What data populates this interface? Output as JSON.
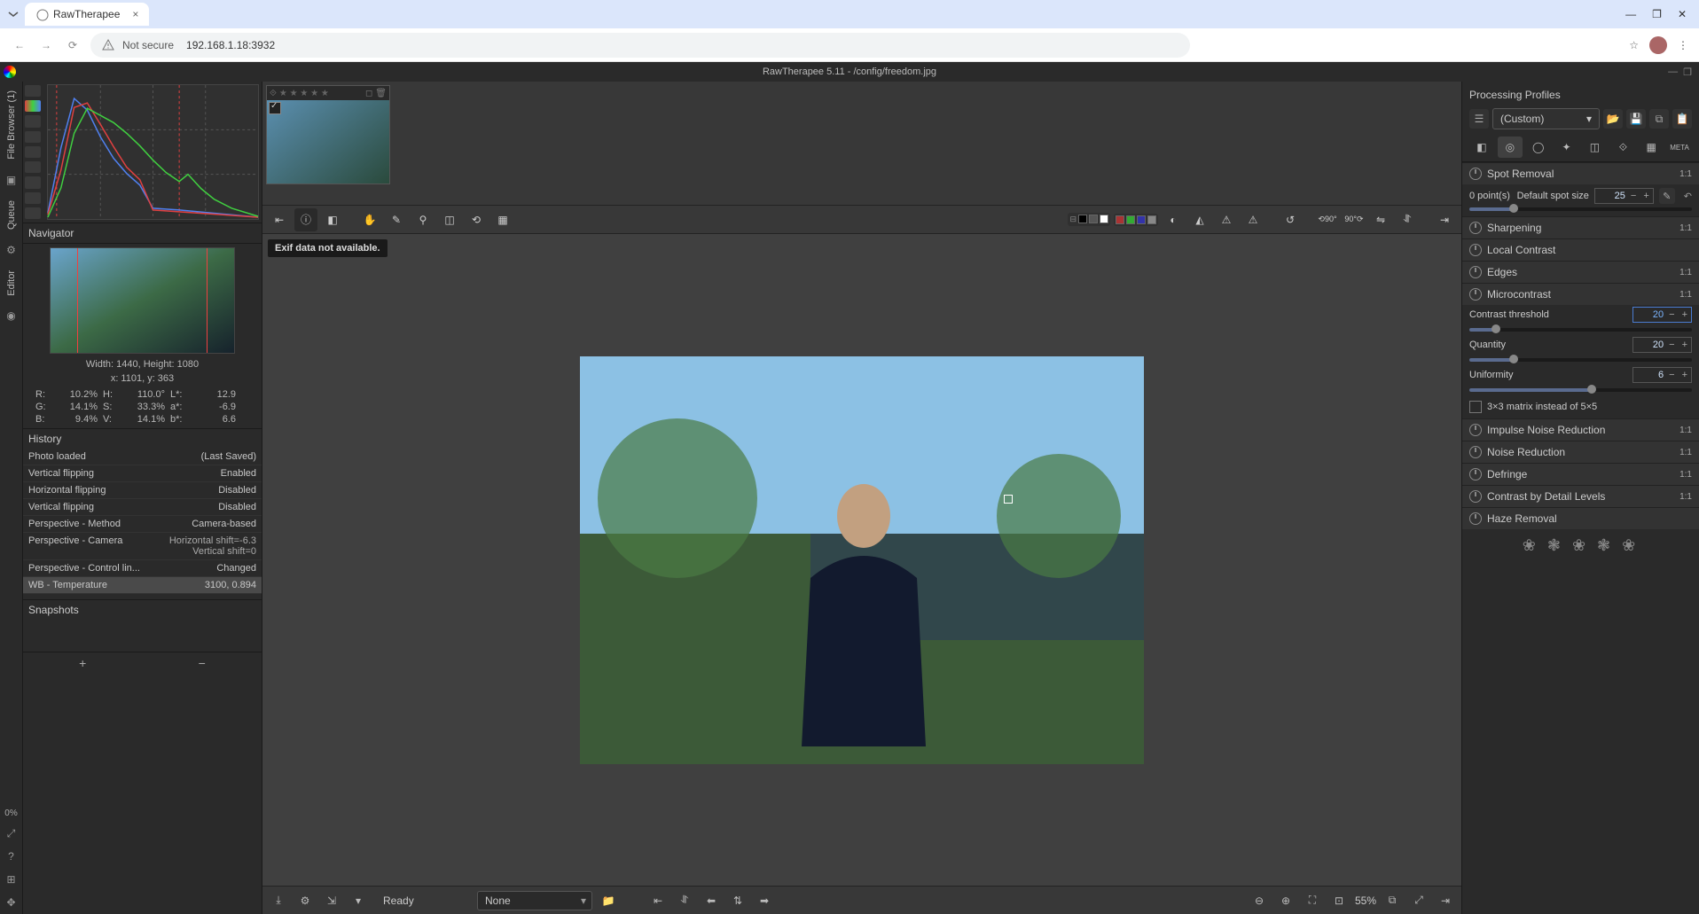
{
  "browser": {
    "tab_title": "RawTherapee",
    "address_prefix": "Not secure",
    "address": "192.168.1.18:3932"
  },
  "titlebar": {
    "text": "RawTherapee 5.11 - /config/freedom.jpg"
  },
  "navigator": {
    "title": "Navigator",
    "dims": "Width: 1440, Height: 1080",
    "pos": "x: 1101, y: 363",
    "R": "10.2%",
    "G": "14.1%",
    "B": "9.4%",
    "H": "110.0°",
    "S": "33.3%",
    "V": "14.1%",
    "Lstar": "12.9",
    "astar": "-6.9",
    "bstar": "6.6"
  },
  "history": {
    "title": "History",
    "rows": [
      {
        "l": "Photo loaded",
        "r": "(Last Saved)"
      },
      {
        "l": "Vertical flipping",
        "r": "Enabled"
      },
      {
        "l": "Horizontal flipping",
        "r": "Disabled"
      },
      {
        "l": "Vertical flipping",
        "r": "Disabled"
      },
      {
        "l": "Perspective - Method",
        "r": "Camera-based"
      },
      {
        "l": "Perspective - Camera",
        "r": "Horizontal shift=-6.3",
        "r2": "Vertical shift=0"
      },
      {
        "l": "Perspective - Control lin...",
        "r": "Changed"
      },
      {
        "l": "WB - Temperature",
        "r": "3100, 0.894"
      }
    ]
  },
  "snapshots": {
    "title": "Snapshots"
  },
  "leftbar": {
    "filebrowser": "File Browser (1)",
    "queue": "Queue",
    "editor": "Editor",
    "zoom": "0%"
  },
  "exif_badge": "Exif data not available.",
  "statusbar": {
    "status": "Ready",
    "dropdown": "None",
    "zoom": "55%"
  },
  "right": {
    "profiles_title": "Processing Profiles",
    "profile": "(Custom)",
    "panels": {
      "spot": {
        "title": "Spot Removal",
        "points": "0 point(s)",
        "defsize_label": "Default spot size",
        "defsize": "25"
      },
      "sharp": "Sharpening",
      "local": "Local Contrast",
      "edges": "Edges",
      "micro": {
        "title": "Microcontrast",
        "contrast_label": "Contrast threshold",
        "contrast": "20",
        "quantity_label": "Quantity",
        "quantity": "20",
        "uniform_label": "Uniformity",
        "uniform": "6",
        "matrix": "3×3 matrix instead of 5×5"
      },
      "impulse": "Impulse Noise Reduction",
      "noise": "Noise Reduction",
      "defringe": "Defringe",
      "contrast_detail": "Contrast by Detail Levels",
      "haze": "Haze Removal"
    }
  },
  "chart_data": {
    "type": "line",
    "title": "RGB Histogram",
    "xlabel": "",
    "ylabel": "",
    "x": [
      0,
      16,
      32,
      48,
      64,
      80,
      96,
      112,
      128,
      144,
      160,
      176,
      192,
      208,
      224,
      240,
      255
    ],
    "series": [
      {
        "name": "R",
        "color": "#e04040",
        "values": [
          5,
          60,
          135,
          140,
          110,
          85,
          62,
          48,
          36,
          28,
          22,
          17,
          12,
          9,
          6,
          4,
          2
        ]
      },
      {
        "name": "G",
        "color": "#40d040",
        "values": [
          2,
          40,
          100,
          128,
          120,
          112,
          100,
          86,
          70,
          56,
          46,
          50,
          38,
          26,
          16,
          8,
          3
        ]
      },
      {
        "name": "B",
        "color": "#5080f0",
        "values": [
          10,
          85,
          145,
          126,
          96,
          72,
          55,
          42,
          32,
          25,
          19,
          14,
          10,
          7,
          4,
          2,
          1
        ]
      }
    ],
    "xlim": [
      0,
      255
    ],
    "ylim": [
      0,
      160
    ]
  }
}
